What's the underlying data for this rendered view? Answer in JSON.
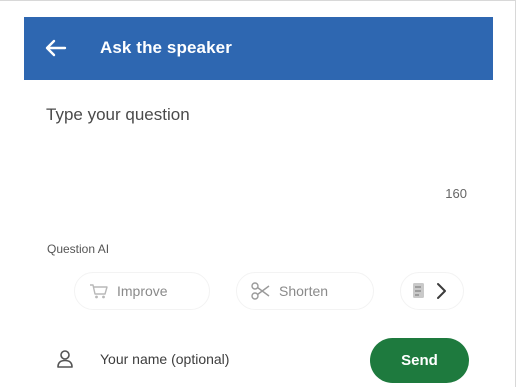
{
  "colors": {
    "header_bg": "#2e67b1",
    "send_bg": "#1e7a3e"
  },
  "header": {
    "back_icon": "arrow-left-icon",
    "title": "Ask the speaker"
  },
  "question": {
    "placeholder": "Type your question",
    "value": "",
    "char_count": "160"
  },
  "question_ai": {
    "label": "Question AI",
    "actions": [
      {
        "label": "Improve",
        "icon": "cart-icon"
      },
      {
        "label": "Shorten",
        "icon": "scissors-icon"
      }
    ],
    "more_icon": "chevron-right-icon"
  },
  "name": {
    "icon": "person-icon",
    "placeholder": "Your name (optional)",
    "value": ""
  },
  "send": {
    "label": "Send"
  }
}
